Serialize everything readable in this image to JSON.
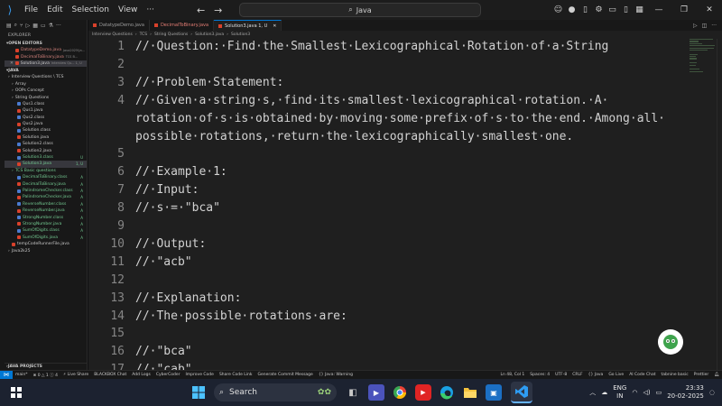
{
  "titlebar": {
    "menu": [
      "File",
      "Edit",
      "Selection",
      "View"
    ],
    "search": "Java"
  },
  "sidebar": {
    "explorer": "EXPLORER",
    "open_editors": "OPEN EDITORS",
    "open_files": [
      {
        "name": "DatatypeDemo.java",
        "detail": "Java2025\\Ja...",
        "color": "red"
      },
      {
        "name": "DecimalToBinary.java",
        "detail": "TCS B...",
        "color": "red"
      },
      {
        "name": "Solution3.java",
        "detail": "Interview Qu...  1, U",
        "color": "sel"
      }
    ],
    "workspace": "JAVA",
    "tree": [
      {
        "label": "Interview Questions \\ TCS",
        "indent": 4,
        "kind": "folder"
      },
      {
        "label": "Array",
        "indent": 8,
        "kind": "folder"
      },
      {
        "label": "OOPs Concept",
        "indent": 8,
        "kind": "folder"
      },
      {
        "label": "String Questions",
        "indent": 8,
        "kind": "folder"
      },
      {
        "label": "Qus1.class",
        "indent": 14,
        "kind": "class"
      },
      {
        "label": "Qus1.java",
        "indent": 14,
        "kind": "java"
      },
      {
        "label": "Qus2.class",
        "indent": 14,
        "kind": "class"
      },
      {
        "label": "Qus2.java",
        "indent": 14,
        "kind": "java"
      },
      {
        "label": "Solution.class",
        "indent": 14,
        "kind": "class"
      },
      {
        "label": "Solution.java",
        "indent": 14,
        "kind": "java"
      },
      {
        "label": "Solution2.class",
        "indent": 14,
        "kind": "class"
      },
      {
        "label": "Solution2.java",
        "indent": 14,
        "kind": "java"
      },
      {
        "label": "Solution3.class",
        "indent": 14,
        "kind": "class-new",
        "status": "U"
      },
      {
        "label": "Solution3.java",
        "indent": 14,
        "kind": "java-sel",
        "status": "1, U"
      },
      {
        "label": "TCS Basic questions",
        "indent": 8,
        "kind": "folder-green"
      },
      {
        "label": "DecimalToBinary.class",
        "indent": 14,
        "kind": "class-new",
        "status": "A"
      },
      {
        "label": "DecimalToBinary.java",
        "indent": 14,
        "kind": "java-new",
        "status": "A"
      },
      {
        "label": "PalindromeChecker.class",
        "indent": 14,
        "kind": "class-new",
        "status": "A"
      },
      {
        "label": "PalindromeChecker.java",
        "indent": 14,
        "kind": "java-new",
        "status": "A"
      },
      {
        "label": "ReverseNumber.class",
        "indent": 14,
        "kind": "class-new",
        "status": "A"
      },
      {
        "label": "ReverseNumber.java",
        "indent": 14,
        "kind": "java-new",
        "status": "A"
      },
      {
        "label": "StrongNumber.class",
        "indent": 14,
        "kind": "class-new",
        "status": "A"
      },
      {
        "label": "StrongNumber.java",
        "indent": 14,
        "kind": "java-new",
        "status": "A"
      },
      {
        "label": "SumOfDigits.class",
        "indent": 14,
        "kind": "class-new",
        "status": "A"
      },
      {
        "label": "SumOfDigits.java",
        "indent": 14,
        "kind": "java-new",
        "status": "A"
      },
      {
        "label": "tempCodeRunnerFile.java",
        "indent": 8,
        "kind": "java"
      },
      {
        "label": "Java2k25",
        "indent": 4,
        "kind": "folder"
      }
    ],
    "java_projects": "JAVA PROJECTS"
  },
  "tabs": [
    {
      "label": "DatatypeDemo.java",
      "state": "normal"
    },
    {
      "label": "DecimalToBinary.java",
      "state": "red"
    },
    {
      "label": "Solution3.java 1, U",
      "state": "active"
    }
  ],
  "breadcrumb": [
    "Interview Questions",
    "TCS",
    "String Questions",
    "Solution3.java",
    "Solution3"
  ],
  "code_lines": [
    {
      "n": "1",
      "text": "//·Question:·Find·the·Smallest·Lexicographical·Rotation·of·a·String"
    },
    {
      "n": "2",
      "text": ""
    },
    {
      "n": "3",
      "text": "//·Problem·Statement:"
    },
    {
      "n": "4",
      "text": "//·Given·a·string·s,·find·its·smallest·lexicographical·rotation.·A·"
    },
    {
      "n": "",
      "text": "rotation·of·s·is·obtained·by·moving·some·prefix·of·s·to·the·end.·Among·all·"
    },
    {
      "n": "",
      "text": "possible·rotations,·return·the·lexicographically·smallest·one."
    },
    {
      "n": "5",
      "text": ""
    },
    {
      "n": "6",
      "text": "//·Example·1:"
    },
    {
      "n": "7",
      "text": "//·Input:"
    },
    {
      "n": "8",
      "text": "//·s·=·\"bca\""
    },
    {
      "n": "9",
      "text": ""
    },
    {
      "n": "10",
      "text": "//·Output:"
    },
    {
      "n": "11",
      "text": "//·\"acb\""
    },
    {
      "n": "12",
      "text": ""
    },
    {
      "n": "13",
      "text": "//·Explanation:"
    },
    {
      "n": "14",
      "text": "//·The·possible·rotations·are:"
    },
    {
      "n": "15",
      "text": ""
    },
    {
      "n": "16",
      "text": "//·\"bca\""
    },
    {
      "n": "17",
      "text": "//·\"cab\""
    }
  ],
  "statusbar": {
    "left": [
      "main*",
      "⊗ 0 △ 1 ⓘ 4",
      "⚡ Live Share",
      "BLACKBOX Chat",
      "Add Logs",
      "CyberCoder",
      "Improve Code",
      "Share Code Link",
      "Generate Commit Message"
    ],
    "java_warning": "{} Java: Warning",
    "right": [
      "Ln 48, Col 1",
      "Spaces: 4",
      "UTF-8",
      "CRLF",
      "{} Java",
      "Go Live",
      "AI Code Chat",
      "tabnine basic",
      "Prettier"
    ]
  },
  "taskbar": {
    "search": "Search",
    "lang_top": "ENG",
    "lang_bottom": "IN",
    "time": "23:33",
    "date": "20-02-2025"
  }
}
